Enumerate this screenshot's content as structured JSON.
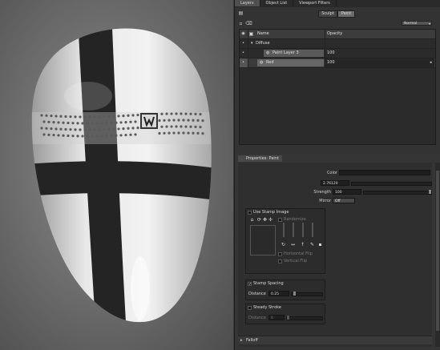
{
  "panel": {
    "tabs": [
      "Layers",
      "Object List",
      "Viewport Filters"
    ],
    "mode_buttons": {
      "sculpt": "Sculpt",
      "paint": "Paint",
      "active": "Paint"
    },
    "blend_mode": "Normal",
    "layers": {
      "header_name": "Name",
      "header_opacity": "Opacity",
      "rows": [
        {
          "name": "Diffuse",
          "value": ""
        },
        {
          "name": "Paint Layer 3",
          "value": "100"
        },
        {
          "name": "Red",
          "value": "100"
        }
      ]
    },
    "properties": {
      "tab": "Properties: Paint",
      "color_label": "Color",
      "color_value": "#1e1e1e",
      "size_label": "Size",
      "size_value": "2.76120",
      "strength_label": "Strength",
      "strength_value": "100",
      "strength_fraction": 1.0,
      "mirror_label": "Mirror",
      "mirror_value": "Off",
      "stamp_image": {
        "label": "Use Stamp Image",
        "randomize": "Randomize",
        "horizontal_flip": "Horizontal Flip",
        "vertical_flip": "Vertical Flip"
      },
      "stamp_spacing": {
        "label": "Stamp Spacing",
        "checked": true,
        "distance_label": "Distance",
        "distance_value": "0.25"
      },
      "steady_stroke": {
        "label": "Steady Stroke",
        "checked": false,
        "distance_label": "Distance",
        "distance_value": "0"
      },
      "falloff_label": "Falloff"
    }
  },
  "colors": {
    "panel_bg": "#333333",
    "cross": "#222222",
    "shield": "#e4e4e4"
  }
}
